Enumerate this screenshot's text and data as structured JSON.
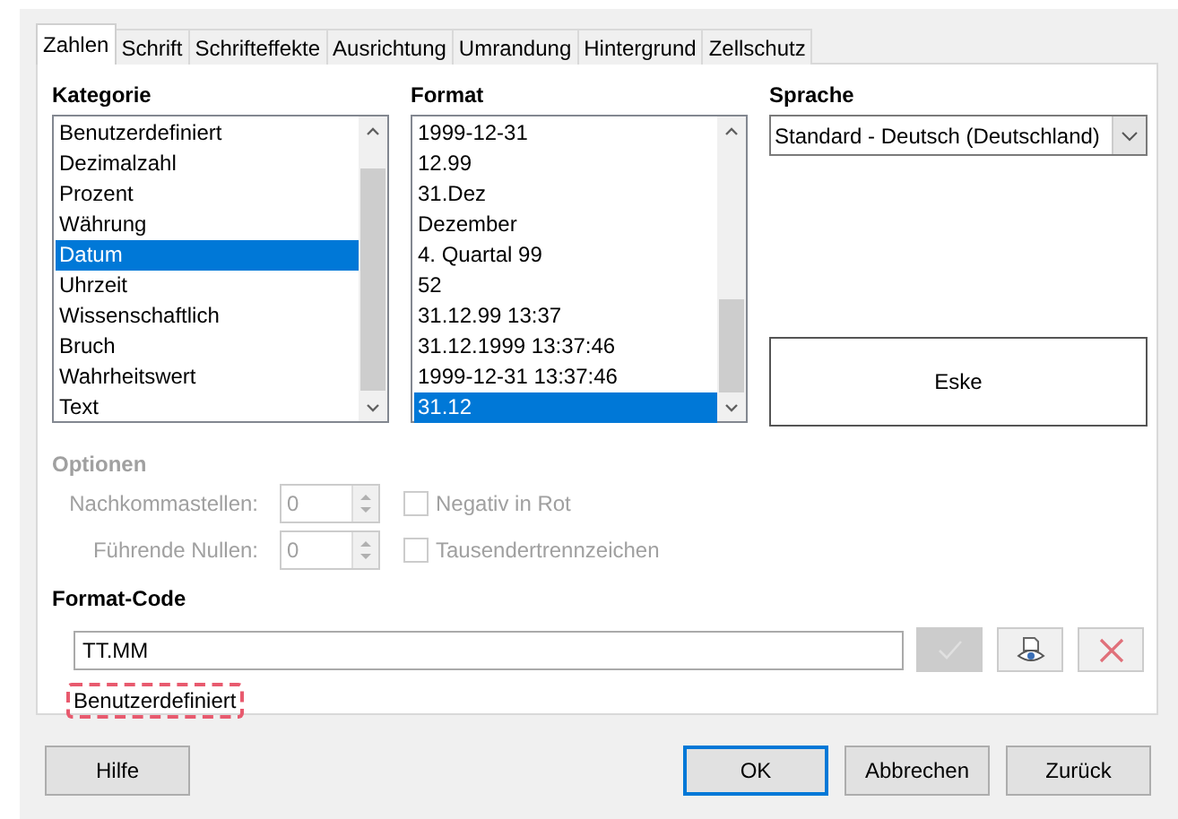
{
  "tabs": [
    {
      "label": "Zahlen",
      "selected": true
    },
    {
      "label": "Schrift",
      "selected": false
    },
    {
      "label": "Schrifteffekte",
      "selected": false
    },
    {
      "label": "Ausrichtung",
      "selected": false
    },
    {
      "label": "Umrandung",
      "selected": false
    },
    {
      "label": "Hintergrund",
      "selected": false
    },
    {
      "label": "Zellschutz",
      "selected": false
    }
  ],
  "category": {
    "label": "Kategorie",
    "items": [
      {
        "label": "Benutzerdefiniert",
        "selected": false
      },
      {
        "label": "Dezimalzahl",
        "selected": false
      },
      {
        "label": "Prozent",
        "selected": false
      },
      {
        "label": "Währung",
        "selected": false
      },
      {
        "label": "Datum",
        "selected": true
      },
      {
        "label": "Uhrzeit",
        "selected": false
      },
      {
        "label": "Wissenschaftlich",
        "selected": false
      },
      {
        "label": "Bruch",
        "selected": false
      },
      {
        "label": "Wahrheitswert",
        "selected": false
      },
      {
        "label": "Text",
        "selected": false
      }
    ]
  },
  "format": {
    "label": "Format",
    "items": [
      {
        "label": "1999-12-31",
        "selected": false
      },
      {
        "label": "12.99",
        "selected": false
      },
      {
        "label": "31.Dez",
        "selected": false
      },
      {
        "label": "Dezember",
        "selected": false
      },
      {
        "label": "4. Quartal 99",
        "selected": false
      },
      {
        "label": "52",
        "selected": false
      },
      {
        "label": "31.12.99 13:37",
        "selected": false
      },
      {
        "label": "31.12.1999 13:37:46",
        "selected": false
      },
      {
        "label": "1999-12-31 13:37:46",
        "selected": false
      },
      {
        "label": "31.12",
        "selected": true
      }
    ]
  },
  "language": {
    "label": "Sprache",
    "value": "Standard - Deutsch (Deutschland)"
  },
  "preview": {
    "text": "Eske"
  },
  "options": {
    "label": "Optionen",
    "disabled": true,
    "spinners": [
      {
        "label": "Nachkommastellen:",
        "value": "0"
      },
      {
        "label": "Führende Nullen:",
        "value": "0"
      }
    ],
    "checkboxes": [
      {
        "label": "Negativ in Rot",
        "checked": false
      },
      {
        "label": "Tausendertrennzeichen",
        "checked": false
      }
    ]
  },
  "format_code": {
    "label": "Format-Code",
    "value": "TT.MM",
    "status": "Benutzerdefiniert",
    "tools": [
      {
        "kind": "accept",
        "disabled": true
      },
      {
        "kind": "comment",
        "disabled": false
      },
      {
        "kind": "delete",
        "disabled": false
      }
    ]
  },
  "buttons": [
    {
      "label": "Hilfe",
      "kind": "help"
    },
    {
      "label": "OK",
      "kind": "default"
    },
    {
      "label": "Abbrechen",
      "kind": "normal"
    },
    {
      "label": "Zurück",
      "kind": "normal"
    }
  ]
}
